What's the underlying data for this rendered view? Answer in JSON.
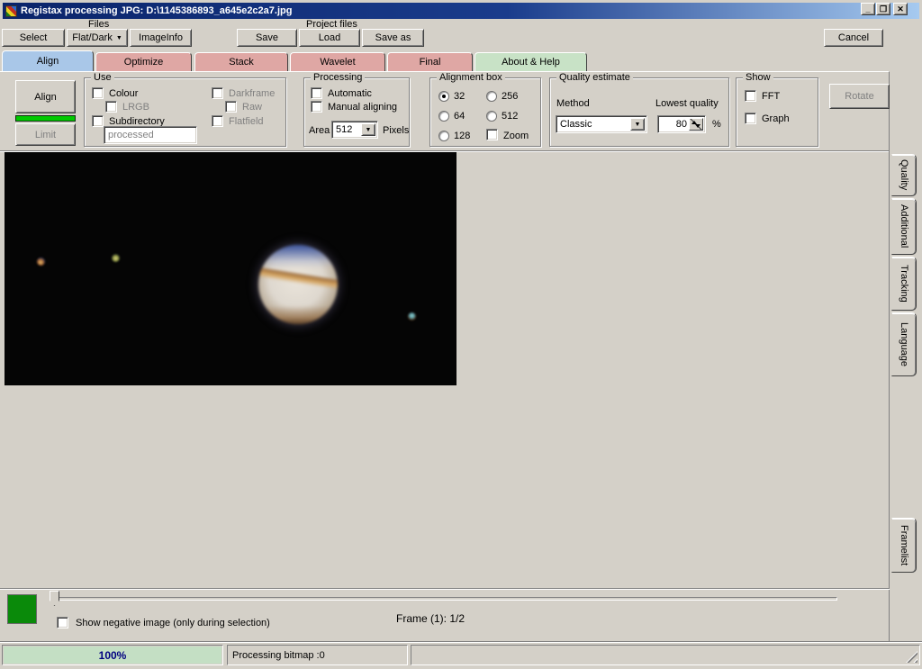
{
  "window": {
    "title": "Registax processing JPG: D:\\1145386893_a645e2c2a7.jpg",
    "minimize_glyph": "_",
    "restore_glyph": "❐",
    "close_glyph": "✕"
  },
  "toolbar": {
    "files_label": "Files",
    "select": "Select",
    "flatdark": "Flat/Dark",
    "imageinfo": "ImageInfo",
    "project_files_label": "Project files",
    "save": "Save",
    "load": "Load",
    "save_as": "Save as",
    "cancel": "Cancel"
  },
  "tabs": [
    {
      "label": "Align",
      "selected": true,
      "color": "#A9C7E8"
    },
    {
      "label": "Optimize",
      "selected": false,
      "color": "#DFA7A4"
    },
    {
      "label": "Stack",
      "selected": false,
      "color": "#DFA7A4"
    },
    {
      "label": "Wavelet",
      "selected": false,
      "color": "#DFA7A4"
    },
    {
      "label": "Final",
      "selected": false,
      "color": "#DFA7A4"
    },
    {
      "label": "About & Help",
      "selected": false,
      "color": "#C8E2C6"
    }
  ],
  "panel": {
    "align_button": "Align",
    "limit_button": "Limit",
    "use": {
      "title": "Use",
      "colour": "Colour",
      "lrgb": "LRGB",
      "subdirectory": "Subdirectory",
      "subdirectory_value": "processed",
      "darkframe": "Darkframe",
      "raw": "Raw",
      "flatfield": "Flatfield"
    },
    "processing": {
      "title": "Processing",
      "automatic": "Automatic",
      "manual": "Manual aligning",
      "area_label": "Area",
      "area_value": "512",
      "pixels_label": "Pixels"
    },
    "alignment_box": {
      "title": "Alignment box",
      "opt32": "32",
      "opt64": "64",
      "opt128": "128",
      "opt256": "256",
      "opt512": "512",
      "zoom": "Zoom",
      "selected_option": "32"
    },
    "quality": {
      "title": "Quality estimate",
      "method_label": "Method",
      "method_value": "Classic",
      "lowest_label": "Lowest quality",
      "lowest_value": "80",
      "percent": "%"
    },
    "show": {
      "title": "Show",
      "fft": "FFT",
      "graph": "Graph"
    },
    "rotate_button": "Rotate"
  },
  "right_tabs": {
    "quality": "Quality",
    "additional": "Additional",
    "tracking": "Tracking",
    "language": "Language",
    "framelist": "Framelist"
  },
  "bottom": {
    "negative_label": "Show negative image (only during selection)",
    "frame_label": "Frame (1): 1/2"
  },
  "statusbar": {
    "progress": "100%",
    "message": "Processing bitmap :0"
  },
  "icons": {
    "dropdown_arrow": "▼"
  },
  "colors": {
    "titlebar_left": "#0A246A",
    "titlebar_right": "#A6CAF0",
    "tab_selected_blue": "#A9C7E8",
    "tab_pink": "#DFA7A4",
    "tab_help_green": "#C8E2C6",
    "align_indicator_green": "#00C800",
    "frame_square_green": "#0A8A0A",
    "progress_fill": "#C4DFC4",
    "progress_text": "#000080",
    "window_grey": "#D4D0C8"
  }
}
